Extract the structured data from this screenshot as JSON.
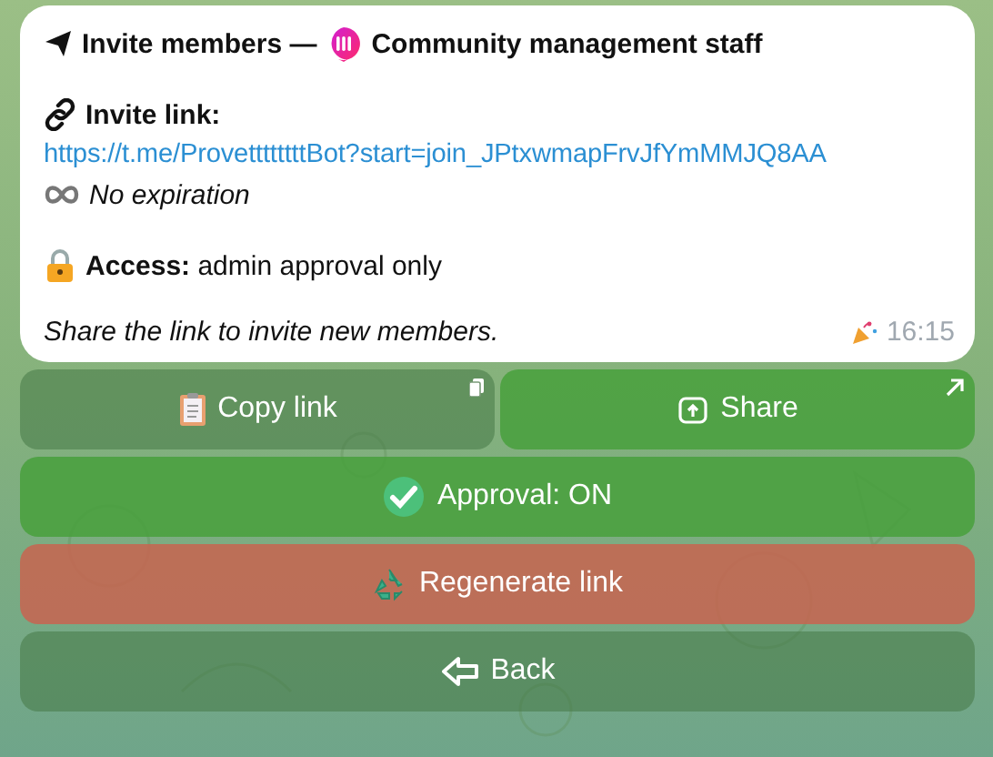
{
  "message": {
    "title_prefix": "Invite members —",
    "title_suffix": "Community management staff",
    "link_label": "Invite link:",
    "link_url": "https://t.me/ProvettttttttBot?start=join_JPtxwmapFrvJfYmMMJQ8AA",
    "expiration": "No expiration",
    "access": "**Access:** admin approval only",
    "note": "Share the link to invite new members.",
    "time": "16:15"
  },
  "buttons": [
    {
      "label": "Copy link",
      "kind": "plain"
    },
    {
      "label": "Share",
      "kind": "success"
    },
    {
      "label": "Approval: ON",
      "kind": "success"
    },
    {
      "label": "Regenerate link",
      "kind": "danger"
    },
    {
      "label": "Back",
      "kind": "plain"
    }
  ]
}
